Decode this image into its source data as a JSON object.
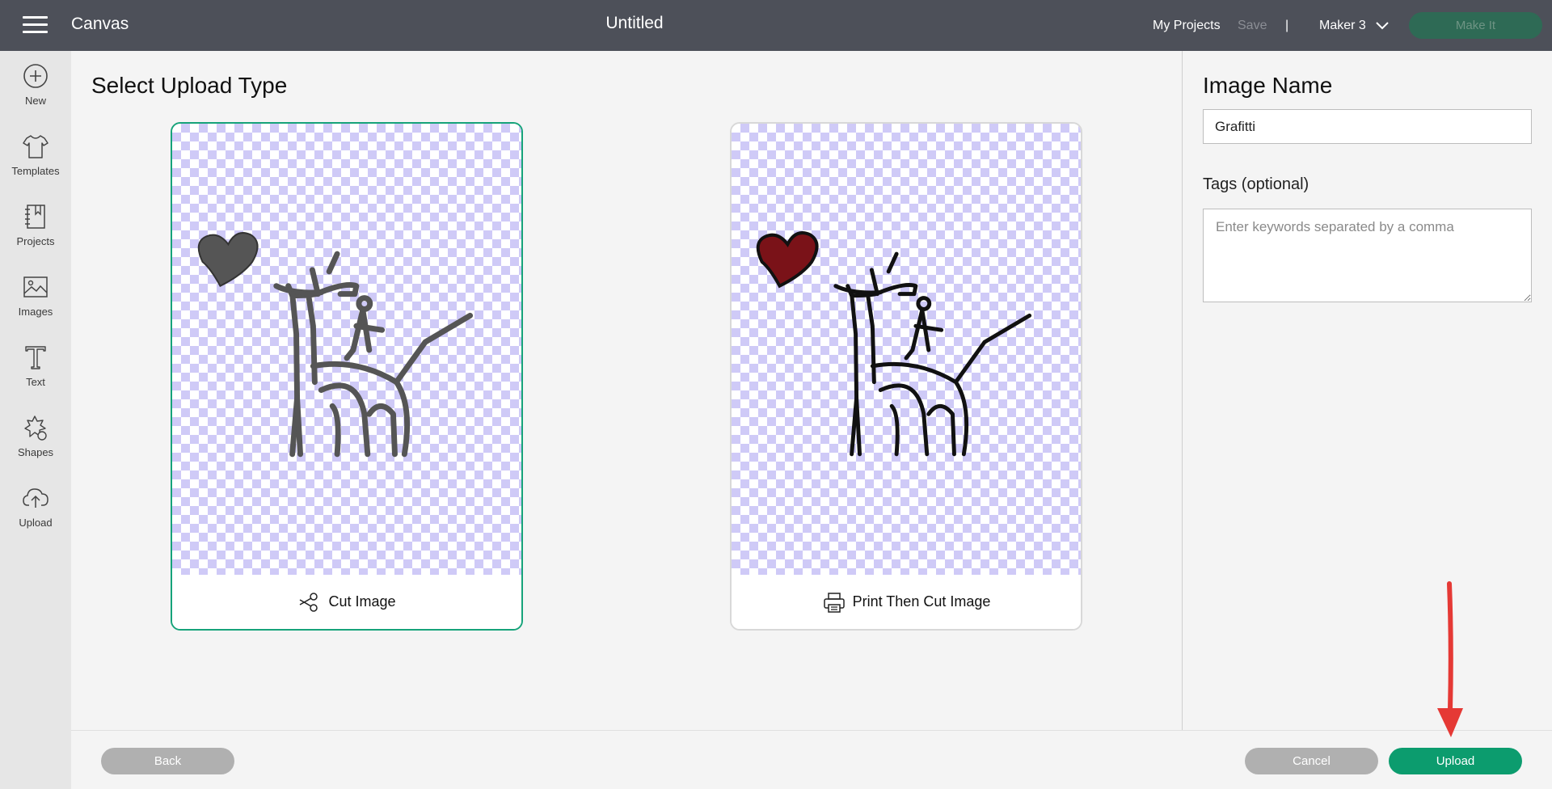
{
  "topbar": {
    "app_name": "Canvas",
    "document_title": "Untitled",
    "my_projects_label": "My Projects",
    "save_label": "Save",
    "divider": "|",
    "machine_label": "Maker 3",
    "make_it_label": "Make It"
  },
  "sidebar": {
    "items": [
      {
        "label": "New",
        "icon": "plus-circle-icon"
      },
      {
        "label": "Templates",
        "icon": "tshirt-icon"
      },
      {
        "label": "Projects",
        "icon": "notebook-icon"
      },
      {
        "label": "Images",
        "icon": "image-icon"
      },
      {
        "label": "Text",
        "icon": "text-t-icon"
      },
      {
        "label": "Shapes",
        "icon": "shapes-icon"
      },
      {
        "label": "Upload",
        "icon": "cloud-upload-icon"
      }
    ]
  },
  "main": {
    "title": "Select Upload Type",
    "cards": [
      {
        "label": "Cut Image",
        "icon": "scissors-icon",
        "selected": true,
        "drawing_color": "#555555",
        "heart_color": "#555555"
      },
      {
        "label": "Print Then Cut Image",
        "icon": "printer-icon",
        "selected": false,
        "drawing_color": "#111111",
        "heart_color": "#7a1218"
      }
    ]
  },
  "right_panel": {
    "image_name_title": "Image Name",
    "image_name_value": "Grafitti",
    "tags_label": "Tags (optional)",
    "tags_placeholder": "Enter keywords separated by a comma",
    "tags_value": ""
  },
  "bottombar": {
    "back_label": "Back",
    "cancel_label": "Cancel",
    "upload_label": "Upload"
  },
  "colors": {
    "topbar": "#4d5059",
    "accent": "#0c9c6e",
    "selected_border": "#16a37a",
    "checker": "#cfcaf7",
    "annotation_arrow": "#e53935"
  }
}
